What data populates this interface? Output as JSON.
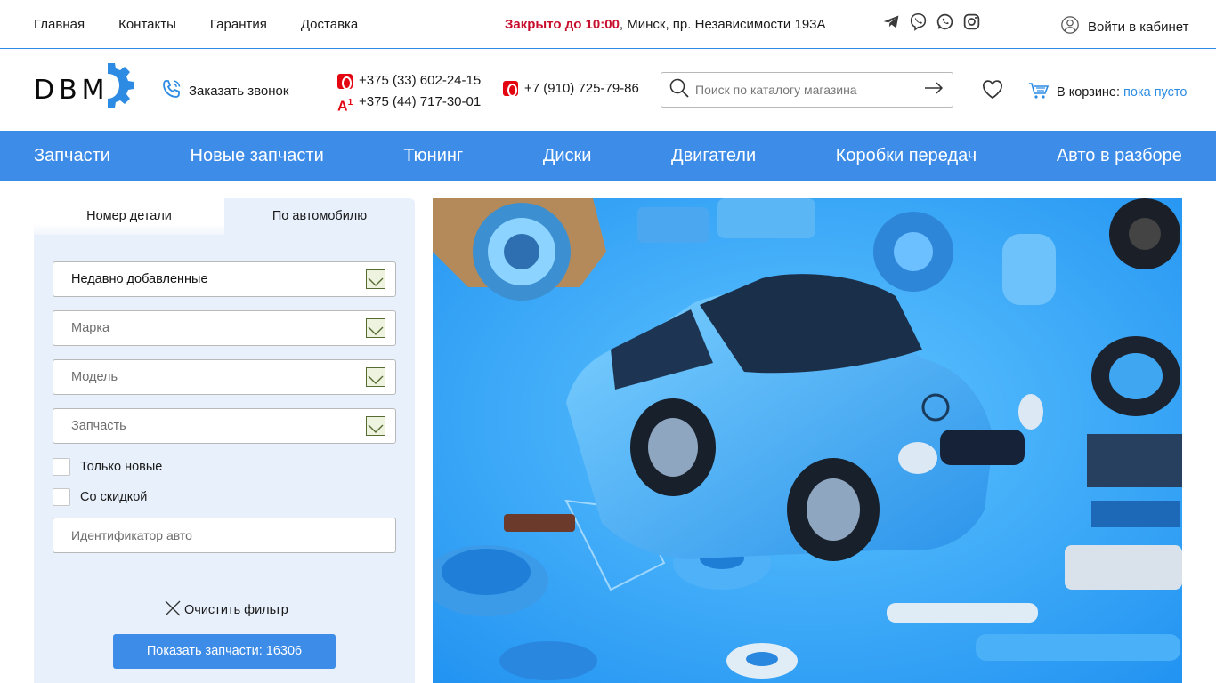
{
  "topbar": {
    "nav": [
      "Главная",
      "Контакты",
      "Гарантия",
      "Доставка"
    ],
    "status_closed": "Закрыто до 10:00",
    "status_address": ", Минск, пр. Независимости 193А",
    "socials": [
      "telegram-icon",
      "viber-icon",
      "whatsapp-icon",
      "instagram-icon"
    ],
    "login_label": "Войти в кабинет"
  },
  "header": {
    "logo_text": "DBM",
    "callback_label": "Заказать звонок",
    "phone_mts_1": "+375 (33) 602-24-15",
    "phone_a1": "+375 (44) 717-30-01",
    "phone_mts_2": "+7 (910) 725-79-86",
    "search_placeholder": "Поиск по каталогу магазина",
    "cart_label": "В корзине:",
    "cart_status": "пока пусто"
  },
  "main_nav": [
    "Запчасти",
    "Новые запчасти",
    "Тюнинг",
    "Диски",
    "Двигатели",
    "Коробки передач",
    "Авто в разборе"
  ],
  "filter": {
    "tabs": [
      "Номер детали",
      "По автомобилю"
    ],
    "active_tab": "По автомобилю",
    "sort_value": "Недавно добавленные",
    "brand_placeholder": "Марка",
    "model_placeholder": "Модель",
    "part_placeholder": "Запчасть",
    "only_new_label": "Только новые",
    "discount_label": "Со скидкой",
    "id_placeholder": "Идентификатор авто",
    "clear_label": "Очистить фильтр",
    "show_button": "Показать запчасти: 16306"
  },
  "colors": {
    "accent": "#3d8ce8",
    "closed": "#c8102e",
    "panel": "#e8f0fb"
  }
}
